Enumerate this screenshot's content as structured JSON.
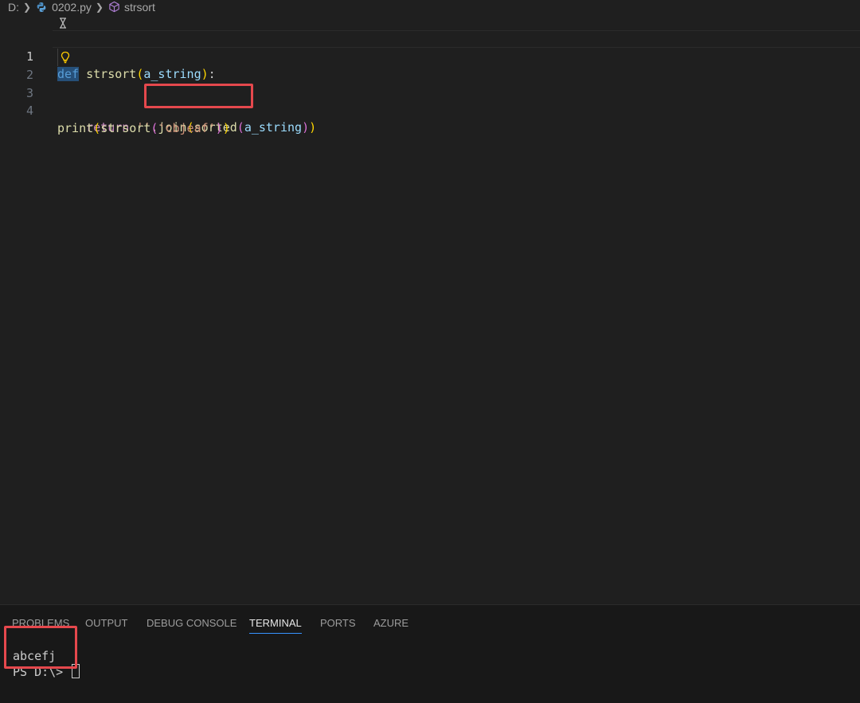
{
  "breadcrumb": {
    "drive": "D:",
    "file": "0202.py",
    "symbol": "strsort"
  },
  "editor": {
    "line_numbers": [
      "1",
      "2",
      "3",
      "4"
    ],
    "line1": {
      "def": "def",
      "space": " ",
      "fn": "strsort",
      "open": "(",
      "param": "a_string",
      "close": ")",
      "colon": ":"
    },
    "line2": {
      "indent": "    ",
      "ret": "return",
      "space": " ",
      "str": "''",
      "join": ".join",
      "open1": "(",
      "sorted": "sorted",
      "open2": "(",
      "param": "a_string",
      "close2": ")",
      "close1": ")"
    },
    "line4": {
      "print": "print",
      "open1": "(",
      "fn": "strsort",
      "open2": "(",
      "str": "'cbjeaf'",
      "close2": ")",
      "close1": ")"
    }
  },
  "panel": {
    "tabs": [
      "PROBLEMS",
      "OUTPUT",
      "DEBUG CONSOLE",
      "TERMINAL",
      "PORTS",
      "AZURE"
    ],
    "active_tab": "TERMINAL"
  },
  "terminal": {
    "output": "abcefj",
    "prompt": "PS D:\\> "
  },
  "colors": {
    "highlight_box": "#e5484d",
    "active_tab_underline": "#3794ff",
    "keyword_def": "#569cd6",
    "keyword_control": "#c586c0",
    "function": "#dcdcaa",
    "parameter": "#9cdcfe",
    "string": "#ce9178",
    "bracket_level1": "#ffd700",
    "bracket_level2": "#da70d6"
  },
  "icons": [
    "chevron-right-icon",
    "python-file-icon",
    "symbol-method-icon",
    "codelens-icon",
    "lightbulb-icon",
    "terminal-cursor"
  ]
}
